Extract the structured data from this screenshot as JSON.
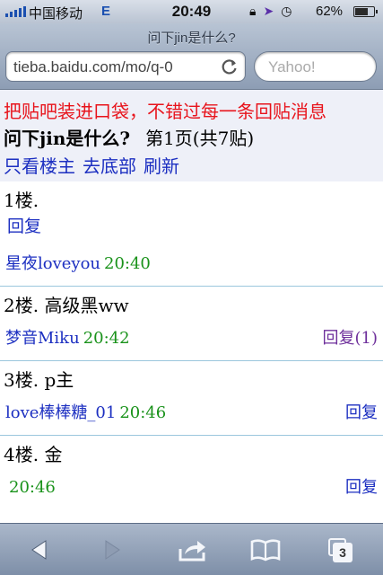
{
  "status_bar": {
    "carrier": "中国移动",
    "network": "E",
    "time": "20:49",
    "battery_percent": "62%",
    "battery_level": 0.62
  },
  "browser": {
    "page_title": "问下jin是什么?",
    "url": "tieba.baidu.com/mo/q-0",
    "search_placeholder": "Yahoo!",
    "tab_count": "3"
  },
  "page": {
    "promo": "把贴吧装进口袋，不错过每一条回贴消息",
    "thread_title": "问下jin是什么?",
    "page_info": "第1页(共7贴)",
    "nav_links": [
      "只看楼主",
      "去底部",
      "刷新"
    ],
    "floors": [
      {
        "label": "1楼.",
        "reply": "回复",
        "user": "星夜loveyou",
        "time": "20:40"
      },
      {
        "label": "2楼. 高级黑ww",
        "user": "梦音Miku",
        "time": "20:42",
        "reply": "回复(1)"
      },
      {
        "label": "3楼. p主",
        "user": "love棒棒糖_01",
        "time": "20:46",
        "reply": "回复"
      },
      {
        "label": "4楼. 金",
        "user": "",
        "time": "20:46",
        "reply": "回复"
      }
    ]
  },
  "colors": {
    "link": "#1c2fc1",
    "promo": "#e8141c",
    "time": "#19921a",
    "reply_count": "#6e2f9b"
  }
}
